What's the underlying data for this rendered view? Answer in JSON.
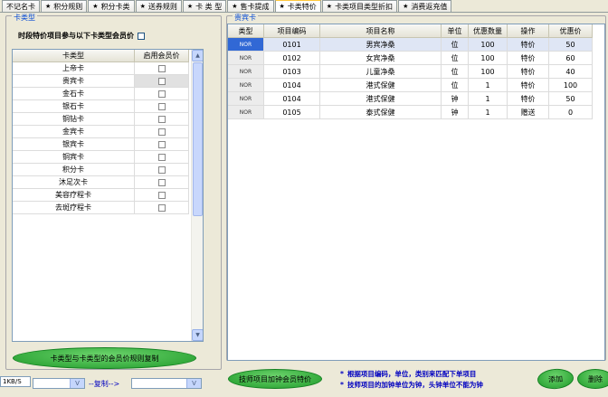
{
  "tabs": [
    {
      "label": "不记名卡",
      "star": false,
      "active": false
    },
    {
      "label": "积分规则",
      "star": true,
      "active": false
    },
    {
      "label": "积分卡类",
      "star": true,
      "active": false
    },
    {
      "label": "送券规则",
      "star": true,
      "active": false
    },
    {
      "label": "卡 类 型",
      "star": true,
      "active": false
    },
    {
      "label": "售卡提成",
      "star": true,
      "active": false
    },
    {
      "label": "卡类特价",
      "star": true,
      "active": true
    },
    {
      "label": "卡类项目类型折扣",
      "star": true,
      "active": false
    },
    {
      "label": "消费返充值",
      "star": true,
      "active": false
    }
  ],
  "tab_star_glyph": "★",
  "left_panel": {
    "caption": "卡类型",
    "option_label": "时段特价项目参与以下卡类型会员价",
    "columns": [
      "卡类型",
      "启用会员价"
    ],
    "rows": [
      {
        "type": "上帝卡"
      },
      {
        "type": "贵宾卡",
        "selected": true
      },
      {
        "type": "金石卡"
      },
      {
        "type": "银石卡"
      },
      {
        "type": "铜钻卡"
      },
      {
        "type": "金宾卡"
      },
      {
        "type": "银宾卡"
      },
      {
        "type": "铜宾卡"
      },
      {
        "type": "积分卡"
      },
      {
        "type": "沐足次卡"
      },
      {
        "type": "美容疗程卡"
      },
      {
        "type": "去斑疗程卡"
      }
    ],
    "copy_button": "卡类型与卡类型的会员价规则复制",
    "speed": "1KB/S",
    "copy_label": "--复制-->",
    "combo_arrow": "V"
  },
  "right_panel": {
    "caption": "贵宾卡",
    "columns": [
      "类型",
      "项目编码",
      "项目名称",
      "单位",
      "优惠数量",
      "操作",
      "优惠价"
    ],
    "rows": [
      {
        "type": "NOR",
        "code": "0101",
        "name": "男宾净桑",
        "unit": "位",
        "qty": "100",
        "op": "特价",
        "price": "50",
        "selected": true
      },
      {
        "type": "NOR",
        "code": "0102",
        "name": "女宾净桑",
        "unit": "位",
        "qty": "100",
        "op": "特价",
        "price": "60"
      },
      {
        "type": "NOR",
        "code": "0103",
        "name": "儿童净桑",
        "unit": "位",
        "qty": "100",
        "op": "特价",
        "price": "40"
      },
      {
        "type": "NOR",
        "code": "0104",
        "name": "港式保健",
        "unit": "位",
        "qty": "1",
        "op": "特价",
        "price": "100"
      },
      {
        "type": "NOR",
        "code": "0104",
        "name": "港式保健",
        "unit": "钟",
        "qty": "1",
        "op": "特价",
        "price": "50"
      },
      {
        "type": "NOR",
        "code": "0105",
        "name": "泰式保健",
        "unit": "钟",
        "qty": "1",
        "op": "赠送",
        "price": "0"
      }
    ],
    "tech_button": "技师项目加钟会员特价",
    "notes": [
      {
        "bullet": "*",
        "text": "根据项目编码，单位，类别来匹配下单项目"
      },
      {
        "bullet": "*",
        "text": "技师项目的加钟单位为钟，头钟单位不能为钟"
      }
    ],
    "add_button": "添加",
    "delete_button": "删除"
  }
}
